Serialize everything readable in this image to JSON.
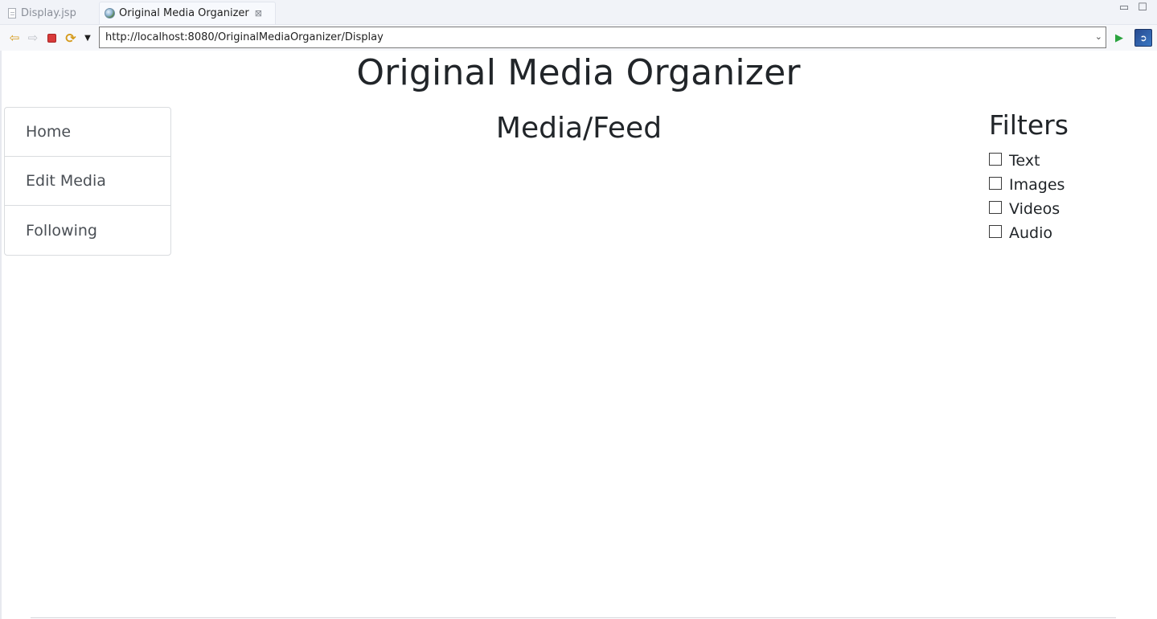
{
  "editor_tabs": [
    {
      "label": "Display.jsp",
      "icon": "file-icon",
      "active": false
    },
    {
      "label": "Original Media Organizer",
      "icon": "globe-icon",
      "active": true,
      "close_glyph": "⊠"
    }
  ],
  "window_controls": {
    "minimize": "▭",
    "maximize": "☐"
  },
  "toolbar": {
    "back_icon": "⇦",
    "forward_icon": "⇨",
    "refresh_icon": "⟳",
    "dropdown_icon": "▼",
    "url": "http://localhost:8080/OriginalMediaOrganizer/Display",
    "url_chevron": "⌄",
    "go_icon": "▶",
    "external_icon": "➲"
  },
  "page": {
    "title": "Original Media Organizer",
    "nav": [
      {
        "label": "Home"
      },
      {
        "label": "Edit Media"
      },
      {
        "label": "Following"
      }
    ],
    "feed_title": "Media/Feed",
    "filters": {
      "title": "Filters",
      "options": [
        {
          "label": "Text",
          "checked": false
        },
        {
          "label": "Images",
          "checked": false
        },
        {
          "label": "Videos",
          "checked": false
        },
        {
          "label": "Audio",
          "checked": false
        }
      ]
    }
  }
}
